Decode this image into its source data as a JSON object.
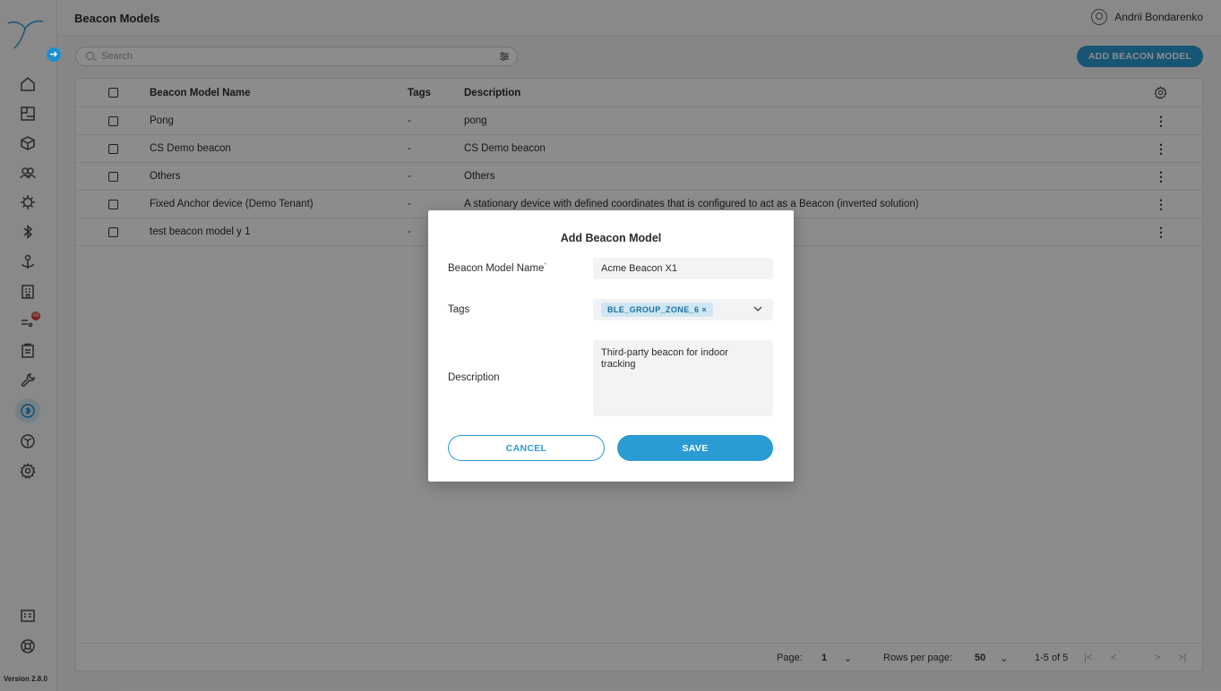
{
  "app": {
    "version": "Version 2.8.0",
    "notification_count": "49"
  },
  "header": {
    "title": "Beacon Models",
    "user_name": "Andrii Bondarenko"
  },
  "toolbar": {
    "search_placeholder": "Search",
    "add_label": "ADD BEACON MODEL"
  },
  "sidebar": {
    "items": [
      {
        "name": "home-icon"
      },
      {
        "name": "floorplan-icon"
      },
      {
        "name": "cube-icon"
      },
      {
        "name": "users-icon"
      },
      {
        "name": "chip-icon"
      },
      {
        "name": "bluetooth-icon"
      },
      {
        "name": "anchor-icon"
      },
      {
        "name": "building-icon"
      },
      {
        "name": "alerts-icon"
      },
      {
        "name": "clipboard-icon"
      },
      {
        "name": "wrench-icon"
      },
      {
        "name": "beacon-icon"
      },
      {
        "name": "package-icon"
      },
      {
        "name": "settings-icon"
      },
      {
        "name": "docs-icon"
      },
      {
        "name": "help-icon"
      }
    ]
  },
  "table": {
    "columns": {
      "name": "Beacon Model Name",
      "tags": "Tags",
      "description": "Description"
    },
    "rows": [
      {
        "name": "Pong",
        "tags": "-",
        "description": "pong"
      },
      {
        "name": "CS Demo beacon",
        "tags": "-",
        "description": "CS Demo beacon"
      },
      {
        "name": "Others",
        "tags": "-",
        "description": "Others"
      },
      {
        "name": "Fixed Anchor device (Demo Tenant)",
        "tags": "-",
        "description": "A stationary device with defined coordinates that is configured to act as a Beacon (inverted solution)"
      },
      {
        "name": "test beacon model y 1",
        "tags": "-",
        "description": ""
      }
    ]
  },
  "pagination": {
    "page_label": "Page:",
    "page_value": "1",
    "rows_label": "Rows per page:",
    "rows_value": "50",
    "range": "1-5 of 5"
  },
  "modal": {
    "title": "Add Beacon Model",
    "name_label": "Beacon Model Name",
    "required_mark": "*",
    "name_value": "Acme Beacon X1",
    "tags_label": "Tags",
    "tag_chip": "BLE_GROUP_ZONE_6",
    "description_label": "Description",
    "description_value": "Third-party beacon for indoor tracking",
    "cancel_label": "CANCEL",
    "save_label": "SAVE"
  },
  "colors": {
    "accent": "#2b9bd4",
    "badge": "#d9403a"
  }
}
